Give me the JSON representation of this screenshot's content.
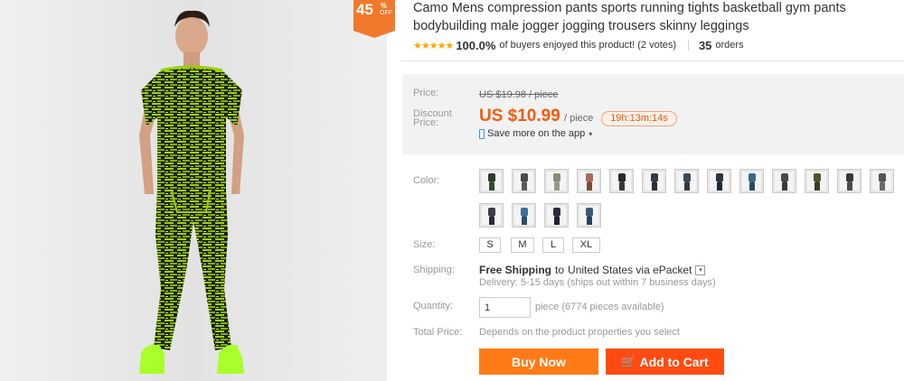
{
  "product": {
    "title": "Camo Mens compression pants sports running tights basketball gym pants bodybuilding male jogger jogging trousers skinny leggings",
    "discount": {
      "percent": "45",
      "sign": "%",
      "off": "OFF"
    }
  },
  "rating": {
    "stars": "★★★★★",
    "percent": "100.0%",
    "text": "of buyers enjoyed this product! (2 votes)",
    "separator": "|",
    "orders_count": "35",
    "orders_label": "orders"
  },
  "price": {
    "label": "Price:",
    "original": "US $19.98 / piece",
    "discount_label_1": "Discount",
    "discount_label_2": "Price:",
    "discounted": "US $10.99",
    "unit": "/ piece",
    "countdown": "19h:13m:14s",
    "app_text": "Save more on the app",
    "app_caret": "▾"
  },
  "options": {
    "color_label": "Color:",
    "colors": [
      {
        "name": "swatch-1",
        "shirt": "#2f3a2a",
        "pants": "#3a4a2e"
      },
      {
        "name": "swatch-2",
        "shirt": "#4a4a4a",
        "pants": "#5a5a5a"
      },
      {
        "name": "swatch-3",
        "shirt": "#8a8a7a",
        "pants": "#9b9686"
      },
      {
        "name": "swatch-4",
        "shirt": "#a86b5a",
        "pants": "#7a4a3a"
      },
      {
        "name": "swatch-5",
        "shirt": "#2a2a2a",
        "pants": "#383838"
      },
      {
        "name": "swatch-6",
        "shirt": "#333b44",
        "pants": "#2a2e33"
      },
      {
        "name": "swatch-7",
        "shirt": "#3b4a5a",
        "pants": "#2f3a44"
      },
      {
        "name": "swatch-8",
        "shirt": "#2a3440",
        "pants": "#1f2a33"
      },
      {
        "name": "swatch-9",
        "shirt": "#356a86",
        "pants": "#2b4a5e"
      },
      {
        "name": "swatch-10",
        "shirt": "#494949",
        "pants": "#3a3a3a"
      },
      {
        "name": "swatch-11",
        "shirt": "#4a5a2a",
        "pants": "#3a3a2a"
      },
      {
        "name": "swatch-12",
        "shirt": "#3a3a3a",
        "pants": "#4a4a4a"
      },
      {
        "name": "swatch-13",
        "shirt": "#555555",
        "pants": "#6a6a6a"
      },
      {
        "name": "swatch-14",
        "shirt": "#3a3d46",
        "pants": "#2a2d33"
      },
      {
        "name": "swatch-15",
        "shirt": "#3d6f9a",
        "pants": "#2a4e6e"
      },
      {
        "name": "swatch-16",
        "shirt": "#2a2d40",
        "pants": "#1f2233"
      },
      {
        "name": "swatch-17",
        "shirt": "#3a5a7a",
        "pants": "#2a4058"
      }
    ],
    "size_label": "Size:",
    "sizes": [
      "S",
      "M",
      "L",
      "XL"
    ]
  },
  "shipping": {
    "label": "Shipping:",
    "free": "Free Shipping",
    "to": "to",
    "destination": "United States via ePacket",
    "dropdown": "▾",
    "delivery": "Delivery: 5-15 days (ships out within 7 business days)"
  },
  "quantity": {
    "label": "Quantity:",
    "value": "1",
    "availability": "piece (6774 pieces available)"
  },
  "total": {
    "label": "Total Price:",
    "text": "Depends on the product properties you select"
  },
  "actions": {
    "buy_now": "Buy Now",
    "add_to_cart": "Add to Cart",
    "cart_icon": "🛒"
  },
  "colors": {
    "accent_orange": "#ff7a17",
    "cart_red": "#ff4b12",
    "price_orange": "#f55a0e",
    "camo_green": "#9bd10f"
  }
}
